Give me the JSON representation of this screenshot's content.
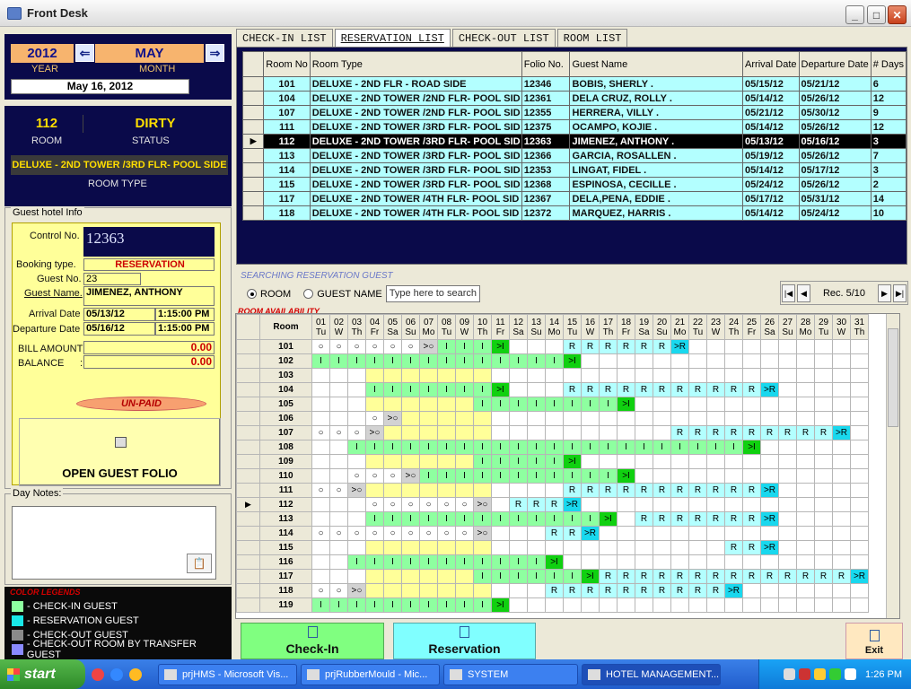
{
  "window": {
    "title": "Front Desk"
  },
  "date_panel": {
    "year": "2012",
    "year_label": "YEAR",
    "month": "MAY",
    "month_label": "MONTH",
    "date": "May 16, 2012"
  },
  "room_panel": {
    "room": "112",
    "room_label": "ROOM",
    "status": "DIRTY",
    "status_label": "STATUS",
    "room_type": "DELUXE - 2ND TOWER /3RD FLR- POOL SIDE",
    "room_type_label": "ROOM TYPE"
  },
  "guest_info": {
    "group_label": "Guest hotel Info",
    "control_label": "Control No.",
    "control_no": "12363",
    "booking_label": "Booking type.",
    "booking_type": "RESERVATION",
    "guest_no_label": "Guest No.",
    "guest_no": "23",
    "guest_name_label": "Guest Name.",
    "guest_name": "JIMENEZ, ANTHONY",
    "arrival_label": "Arrival Date",
    "arrival_date": "05/13/12",
    "arrival_time": "1:15:00 PM",
    "departure_label": "Departure Date",
    "departure_date": "05/16/12",
    "departure_time": "1:15:00 PM",
    "bill_label": "BILL AMOUNT :",
    "bill_amount": "0.00",
    "balance_label": "BALANCE",
    "balance_sep": ":",
    "balance": "0.00",
    "payment_status": "UN-PAID",
    "folio_button": "OPEN GUEST FOLIO"
  },
  "day_notes": {
    "label": "Day Notes:"
  },
  "color_legend": {
    "title": "COLOR LEGENDS",
    "items": [
      {
        "label": " - CHECK-IN GUEST",
        "color": "#8effa0"
      },
      {
        "label": " - RESERVATION GUEST",
        "color": "#19e8e8"
      },
      {
        "label": " - CHECK-OUT GUEST",
        "color": "#8a8a8a"
      },
      {
        "label": " - CHECK-OUT ROOM BY TRANSFER GUEST",
        "color": "#8a8aff"
      }
    ]
  },
  "tabs": [
    "CHECK-IN LIST",
    "RESERVATION LIST",
    "CHECK-OUT LIST",
    "ROOM LIST"
  ],
  "reservation_table": {
    "headers": [
      "Room No",
      "Room Type",
      "Folio No.",
      "Guest Name",
      "Arrival Date",
      "Departure Date",
      "# Days"
    ],
    "rows": [
      [
        "101",
        "DELUXE - 2ND FLR - ROAD SIDE",
        "12346",
        "BOBIS, SHERLY .",
        "05/15/12",
        "05/21/12",
        "6"
      ],
      [
        "104",
        "DELUXE - 2ND TOWER /2ND FLR- POOL SID",
        "12361",
        "DELA CRUZ, ROLLY .",
        "05/14/12",
        "05/26/12",
        "12"
      ],
      [
        "107",
        "DELUXE - 2ND TOWER /2ND FLR- POOL SID",
        "12355",
        "HERRERA, VILLY .",
        "05/21/12",
        "05/30/12",
        "9"
      ],
      [
        "111",
        "DELUXE - 2ND TOWER /3RD FLR- POOL SID",
        "12375",
        "OCAMPO, KOJIE .",
        "05/14/12",
        "05/26/12",
        "12"
      ],
      [
        "112",
        "DELUXE - 2ND TOWER /3RD FLR- POOL SID",
        "12363",
        "JIMENEZ, ANTHONY .",
        "05/13/12",
        "05/16/12",
        "3"
      ],
      [
        "113",
        "DELUXE - 2ND TOWER /3RD FLR- POOL SID",
        "12366",
        "GARCIA, ROSALLEN .",
        "05/19/12",
        "05/26/12",
        "7"
      ],
      [
        "114",
        "DELUXE - 2ND TOWER /3RD FLR- POOL SID",
        "12353",
        "LINGAT, FIDEL .",
        "05/14/12",
        "05/17/12",
        "3"
      ],
      [
        "115",
        "DELUXE - 2ND TOWER /3RD FLR- POOL SID",
        "12368",
        "ESPINOSA, CECILLE .",
        "05/24/12",
        "05/26/12",
        "2"
      ],
      [
        "117",
        "DELUXE - 2ND TOWER /4TH FLR- POOL SID",
        "12367",
        "DELA,PENA, EDDIE .",
        "05/17/12",
        "05/31/12",
        "14"
      ],
      [
        "118",
        "DELUXE - 2ND TOWER /4TH FLR- POOL SID",
        "12372",
        "MARQUEZ, HARRIS .",
        "05/14/12",
        "05/24/12",
        "10"
      ]
    ],
    "selected_row": 4,
    "selected_marker": "▶"
  },
  "search": {
    "legend": "SEARCHING RESERVATION GUEST",
    "opt_room": "ROOM",
    "opt_guest": "GUEST NAME",
    "placeholder": "Type here to search",
    "record": "Rec. 5/10"
  },
  "availability": {
    "legend": "ROOM AVAILABILITY",
    "room_header": "Room",
    "days": [
      "01",
      "02",
      "03",
      "04",
      "05",
      "06",
      "07",
      "08",
      "09",
      "10",
      "11",
      "12",
      "13",
      "14",
      "15",
      "16",
      "17",
      "18",
      "19",
      "20",
      "21",
      "22",
      "23",
      "24",
      "25",
      "26",
      "27",
      "28",
      "29",
      "30",
      "31"
    ],
    "weekdays": [
      "Tu",
      "W",
      "Th",
      "Fr",
      "Sa",
      "Su",
      "Mo",
      "Tu",
      "W",
      "Th",
      "Fr",
      "Sa",
      "Su",
      "Mo",
      "Tu",
      "W",
      "Th",
      "Fr",
      "Sa",
      "Su",
      "Mo",
      "Tu",
      "W",
      "Th",
      "Fr",
      "Sa",
      "Su",
      "Mo",
      "Tu",
      "W",
      "Th"
    ],
    "rows": [
      {
        "room": "101",
        "cells": "O O O O O O >O I I I >I e e e R R R R R R >R e e e e e e e e e e"
      },
      {
        "room": "102",
        "cells": "I I I I I I I I I I I I I I >I e e e e e e e e e e e e e e e e"
      },
      {
        "room": "103",
        "cells": "e e e y y y y y y y e e e e e e e e e e e e e e e e e e e e e"
      },
      {
        "room": "104",
        "cells": "e e e I I I I I I I >I e e e R R R R R R R R R R R >R e e e e e"
      },
      {
        "room": "105",
        "cells": "e e e y y y y y y I I I I I I I I >I e e e e e e e e e e e e e"
      },
      {
        "room": "106",
        "cells": "e e e O >O y y y y y e e e e e e e e e e e e e e e e e e e e e"
      },
      {
        "room": "107",
        "cells": "O O O >O y y y y y y e e e e e e e e e e R R R R R R R R R >R e"
      },
      {
        "room": "108",
        "cells": "e e I I I I I I I I I I I I I I I I I I I I I I >I e e e e e e"
      },
      {
        "room": "109",
        "cells": "e e e y y y y y y I I I I I >I e e e e e e e e e e e e e e e e"
      },
      {
        "room": "110",
        "cells": "e e O O O >O I I I I I I I I I I I >I e e e e e e e e e e e e e"
      },
      {
        "room": "111",
        "cells": "O O >O y y y y y y y e e e e R R R R R R R R R R R >R e e e e e"
      },
      {
        "room": "112",
        "cells": "e e e O O O O O O >O e R R R >R e e e e e e e e e e e e e e e e"
      },
      {
        "room": "113",
        "cells": "e e e I I I I I I I I I I I I I >I e R R R R R R R >R e e e e e"
      },
      {
        "room": "114",
        "cells": "O O O O O O O O O >O e e e R R >R e e e e e e e e e e e e e e e"
      },
      {
        "room": "115",
        "cells": "e e e y y y y y y y e e e e e e e e e e e e e R R >R e e e e e"
      },
      {
        "room": "116",
        "cells": "e e I I I I I I I I I I I >I e e e e e e e e e e e e e e e e e"
      },
      {
        "room": "117",
        "cells": "e e e y y y y y y I I I I I I >I R R R R R R R R R R R R R R >R"
      },
      {
        "room": "118",
        "cells": "O O >O y y y y y y y e e e R R R R R R R R R R >R e e e e e e e"
      },
      {
        "room": "119",
        "cells": "I I I I I I I I I I >I e e e e e e e e e e e e e e e e e e e e"
      }
    ],
    "current_marker": "▶",
    "current_row": 11
  },
  "actions": {
    "checkin": "Check-In",
    "reservation": "Reservation",
    "exit": "Exit"
  },
  "taskbar": {
    "start": "start",
    "items": [
      "prjHMS - Microsoft Vis...",
      "prjRubberMould - Mic...",
      "SYSTEM",
      "HOTEL MANAGEMENT..."
    ],
    "clock": "1:26 PM"
  }
}
